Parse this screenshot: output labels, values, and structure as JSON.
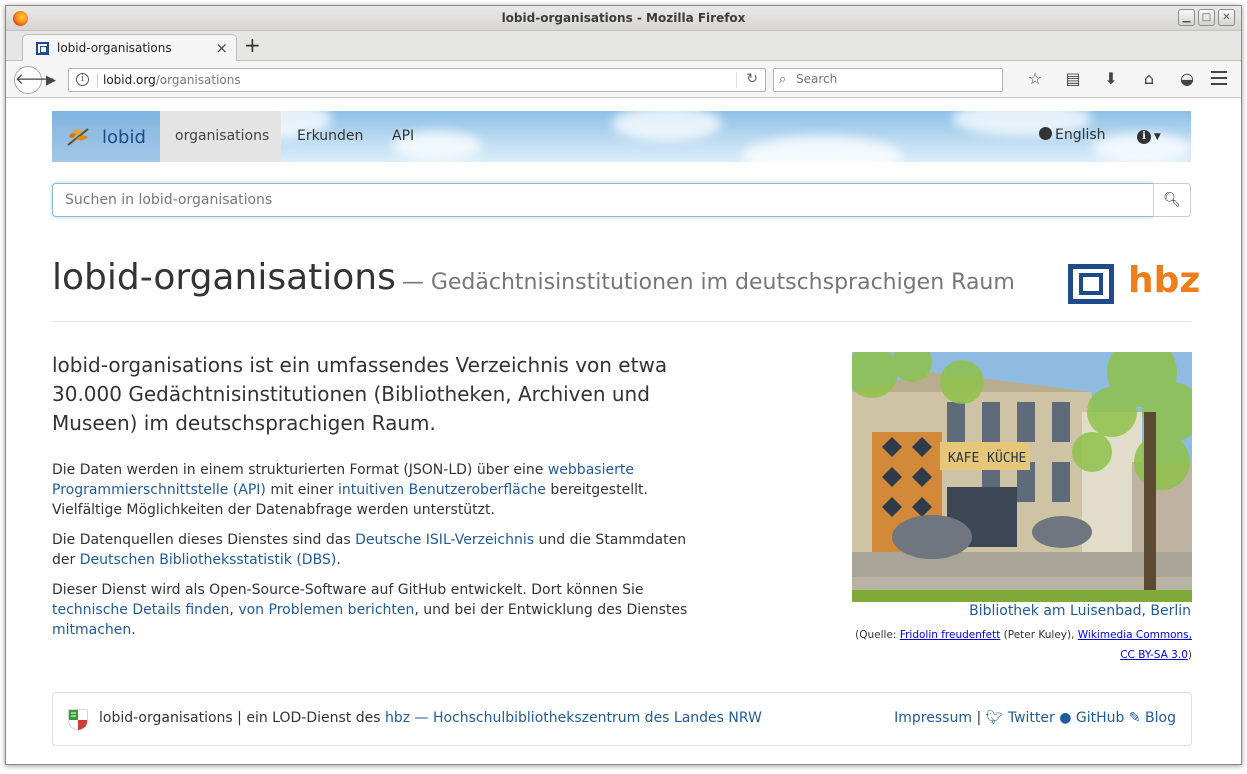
{
  "window": {
    "title": "lobid-organisations - Mozilla Firefox"
  },
  "tab": {
    "label": "lobid-organisations",
    "close": "×",
    "new_tab": "+"
  },
  "urlbar": {
    "host": "lobid.org",
    "path": "/organisations",
    "reload": "↻"
  },
  "browser_search": {
    "placeholder": "Search"
  },
  "site": {
    "brand": "lobid",
    "nav": {
      "active": "organisations",
      "explore": "Erkunden",
      "api": "API"
    },
    "language": "English",
    "search_placeholder": "Suchen in lobid-organisations"
  },
  "header": {
    "title": "lobid-organisations",
    "subtitle": "— Gedächtnisinstitutionen im deutschsprachigen Raum",
    "logo_text": "hbz"
  },
  "intro": {
    "lead": "lobid-organisations ist ein umfassendes Verzeichnis von etwa 30.000 Gedächtnisinstitutionen (Bibliotheken, Archiven und Museen) im deutschsprachigen Raum.",
    "p1": {
      "t1": "Die Daten werden in einem strukturierten Format (JSON-LD) über eine ",
      "l1": "webbasierte Programmierschnittstelle (API)",
      "t2": " mit einer ",
      "l2": "intuitiven Benutzeroberfläche",
      "t3": " bereitgestellt. Vielfältige Möglichkeiten der Datenabfrage werden unterstützt."
    },
    "p2": {
      "t1": "Die Datenquellen dieses Dienstes sind das ",
      "l1": "Deutsche ISIL-Verzeichnis",
      "t2": " und die Stammdaten der ",
      "l2": "Deutschen Bibliotheksstatistik (DBS)",
      "t3": "."
    },
    "p3": {
      "t1": "Dieser Dienst wird als Open-Source-Software auf GitHub entwickelt. Dort können Sie ",
      "l1": "technische Details finden",
      "t2": ", ",
      "l2": "von Problemen berichten",
      "t3": ", und bei der Entwicklung des Dienstes ",
      "l3": "mitmachen",
      "t4": "."
    }
  },
  "photo": {
    "sign": "KAFE KÜCHE",
    "caption": "Bibliothek am Luisenbad, Berlin",
    "source_prefix": "(Quelle: ",
    "author_link": "Fridolin freudenfett",
    "author_name": " (Peter Kuley), ",
    "commons_link": "Wikimedia Commons,",
    "license_link": "CC BY-SA 3.0",
    "source_suffix": ")"
  },
  "footer": {
    "text": "lobid-organisations | ein LOD-Dienst des ",
    "hbz_link": "hbz — Hochschulbibliothekszentrum des Landes NRW",
    "impressum": "Impressum",
    "sep": "|",
    "twitter": "Twitter",
    "github": "GitHub",
    "blog": "Blog"
  }
}
